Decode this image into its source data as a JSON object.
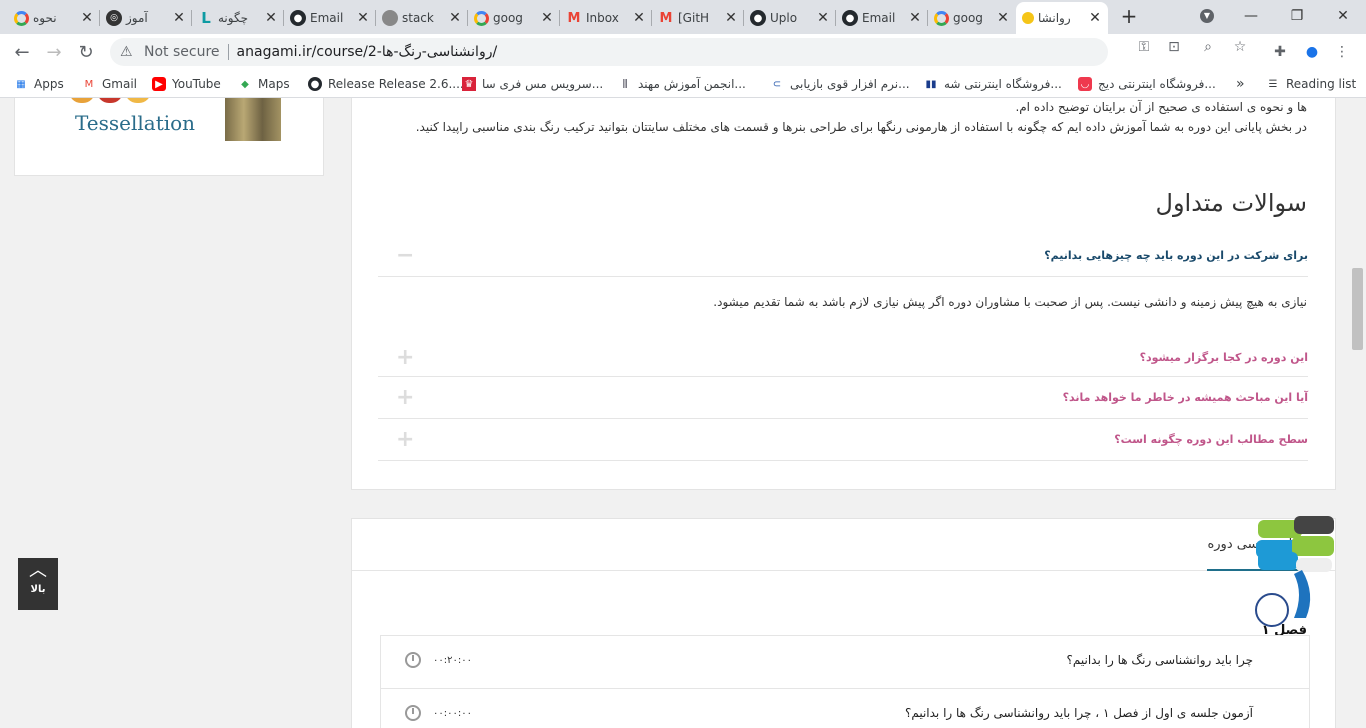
{
  "tabs": [
    {
      "title": "نحوه",
      "icon": "google-icon"
    },
    {
      "title": "آموز",
      "icon": "openai-icon"
    },
    {
      "title": "چگونه",
      "icon": "tl-icon"
    },
    {
      "title": "Email",
      "icon": "github-icon"
    },
    {
      "title": "stack",
      "icon": "stackoverflow-icon"
    },
    {
      "title": "goog",
      "icon": "google-icon"
    },
    {
      "title": "Inbox",
      "icon": "gmail-icon"
    },
    {
      "title": "[GitH",
      "icon": "gmail-icon"
    },
    {
      "title": "Uplo",
      "icon": "github-icon"
    },
    {
      "title": "Email",
      "icon": "github-icon"
    },
    {
      "title": "goog",
      "icon": "google-icon"
    },
    {
      "title": "روانشا",
      "icon": "bee-icon"
    }
  ],
  "new_tab": "+",
  "toolbar": {
    "not_secure": "Not secure",
    "url": "anagami.ir/course/2-روانشناسی-رنگ-ها/"
  },
  "bookmarks": [
    {
      "label": "Apps"
    },
    {
      "label": "Gmail"
    },
    {
      "label": "YouTube"
    },
    {
      "label": "Maps"
    },
    {
      "label": "Release Release 2.6...."
    },
    {
      "label": "سرویس مس فری سا..."
    },
    {
      "label": "انجمن آموزش مهند..."
    },
    {
      "label": "نرم افزار قوی بازیابی..."
    },
    {
      "label": "فروشگاه اینترنتی شه..."
    },
    {
      "label": "فروشگاه اینترنتی دیج..."
    }
  ],
  "bookmarks_more": "»",
  "reading_list": "Reading list",
  "sidebar": {
    "image_word": "Tessellation"
  },
  "intro": {
    "line1": "ها و نحوه ی استفاده ی صحیح از آن برایتان توضیح داده ام.",
    "line2": "در بخش پایانی این دوره به شما آموزش داده ایم که چگونه با استفاده از هارمونی رنگها برای طراحی بنرها و قسمت های مختلف سایتتان بتوانید ترکیب رنگ بندی مناسبی راپیدا کنید."
  },
  "faq": {
    "title": "سوالات متداول",
    "items": [
      {
        "question": "برای شرکت در این دوره باید چه چیزهایی بدانیم؟",
        "toggle": "−",
        "answer": "نیازی به هیچ پیش زمینه و دانشی نیست. پس از صحبت با مشاوران دوره اگر پیش نیازی لازم باشد به شما تقدیم میشود."
      },
      {
        "question": "این دوره در کجا برگزار میشود؟",
        "toggle": "+"
      },
      {
        "question": "آیا این مباحث همیشه در خاطر ما خواهد ماند؟",
        "toggle": "+"
      },
      {
        "question": "سطح مطالب این دوره چگونه است؟",
        "toggle": "+"
      }
    ]
  },
  "curriculum": {
    "tab": "برنامه درسی دوره",
    "chapter": "فصل ۱",
    "lessons": [
      {
        "title": "چرا باید روانشناسی رنگ ها را بدانیم؟",
        "time": "۰۰:۲۰:۰۰"
      },
      {
        "title": "آزمون جلسه ی اول از فصل ۱ ، چرا باید روانشناسی رنگ ها را بدانیم؟",
        "time": "۰۰:۰۰:۰۰"
      }
    ]
  },
  "back_to_top": {
    "label": "بالا"
  },
  "colors": {
    "accent": "#1f6f8b",
    "faq_active": "#1a4a6b",
    "faq_inactive": "#c0568a"
  }
}
